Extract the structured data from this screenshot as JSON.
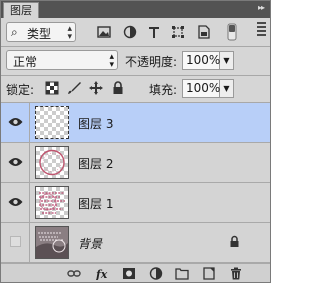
{
  "panel": {
    "tab_label": "图层",
    "collapse_glyph": "▸▸"
  },
  "filter": {
    "kind_label": "类型"
  },
  "blend": {
    "mode": "正常",
    "opacity_label": "不透明度:",
    "opacity_value": "100%"
  },
  "lock": {
    "label": "锁定:",
    "fill_label": "填充:",
    "fill_value": "100%"
  },
  "layers": [
    {
      "name": "图层 3",
      "visible": true,
      "selected": true,
      "thumbnail": "transparent"
    },
    {
      "name": "图层 2",
      "visible": true,
      "selected": false,
      "thumbnail": "stamp-circle"
    },
    {
      "name": "图层 1",
      "visible": true,
      "selected": false,
      "thumbnail": "stamp-text"
    },
    {
      "name": "背景",
      "visible": false,
      "selected": false,
      "locked": true,
      "thumbnail": "background-photo"
    }
  ],
  "colors": {
    "selected_row": "#b8cff8",
    "panel_bg": "#d6d6d6",
    "titlebar": "#535353"
  }
}
